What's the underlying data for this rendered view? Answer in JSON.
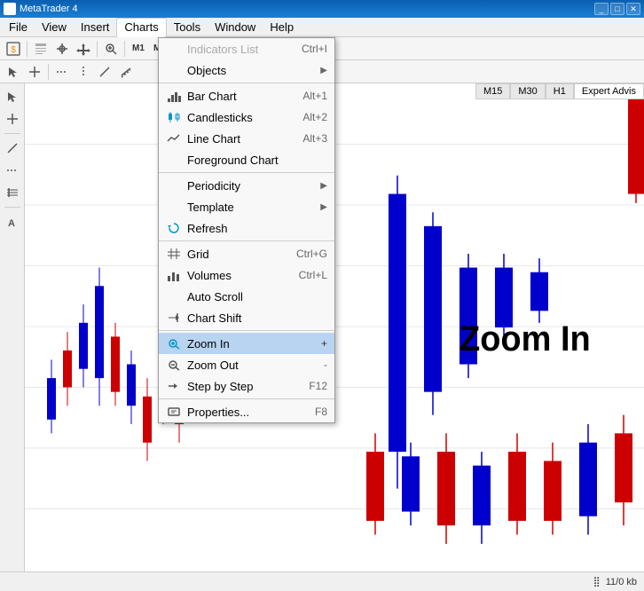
{
  "titlebar": {
    "text": "MetaTrader 4",
    "buttons": [
      "_",
      "□",
      "✕"
    ]
  },
  "menubar": {
    "items": [
      "File",
      "View",
      "Insert",
      "Charts",
      "Tools",
      "Window",
      "Help"
    ],
    "active": "Charts"
  },
  "dropdown": {
    "items": [
      {
        "id": "indicators-list",
        "label": "Indicators List",
        "shortcut": "Ctrl+I",
        "disabled": true,
        "hasIcon": false,
        "hasArrow": false
      },
      {
        "id": "objects",
        "label": "Objects",
        "shortcut": "",
        "disabled": false,
        "hasIcon": false,
        "hasArrow": true
      },
      {
        "id": "sep1",
        "type": "separator"
      },
      {
        "id": "bar-chart",
        "label": "Bar Chart",
        "shortcut": "Alt+1",
        "disabled": false,
        "hasIcon": true,
        "iconType": "bar",
        "hasArrow": false
      },
      {
        "id": "candlesticks",
        "label": "Candlesticks",
        "shortcut": "Alt+2",
        "disabled": false,
        "hasIcon": true,
        "iconType": "candle",
        "hasArrow": false
      },
      {
        "id": "line-chart",
        "label": "Line Chart",
        "shortcut": "Alt+3",
        "disabled": false,
        "hasIcon": true,
        "iconType": "line",
        "hasArrow": false
      },
      {
        "id": "foreground-chart",
        "label": "Foreground Chart",
        "shortcut": "",
        "disabled": false,
        "hasIcon": false,
        "hasArrow": false
      },
      {
        "id": "sep2",
        "type": "separator"
      },
      {
        "id": "periodicity",
        "label": "Periodicity",
        "shortcut": "",
        "disabled": false,
        "hasIcon": false,
        "hasArrow": true
      },
      {
        "id": "template",
        "label": "Template",
        "shortcut": "",
        "disabled": false,
        "hasIcon": false,
        "hasArrow": true
      },
      {
        "id": "refresh",
        "label": "Refresh",
        "shortcut": "",
        "disabled": false,
        "hasIcon": true,
        "iconType": "refresh",
        "hasArrow": false
      },
      {
        "id": "sep3",
        "type": "separator"
      },
      {
        "id": "grid",
        "label": "Grid",
        "shortcut": "Ctrl+G",
        "disabled": false,
        "hasIcon": true,
        "iconType": "grid",
        "hasArrow": false
      },
      {
        "id": "volumes",
        "label": "Volumes",
        "shortcut": "Ctrl+L",
        "disabled": false,
        "hasIcon": true,
        "iconType": "volumes",
        "hasArrow": false
      },
      {
        "id": "auto-scroll",
        "label": "Auto Scroll",
        "shortcut": "",
        "disabled": false,
        "hasIcon": false,
        "hasArrow": false
      },
      {
        "id": "chart-shift",
        "label": "Chart Shift",
        "shortcut": "",
        "disabled": false,
        "hasIcon": true,
        "iconType": "shift",
        "hasArrow": false
      },
      {
        "id": "sep4",
        "type": "separator"
      },
      {
        "id": "zoom-in",
        "label": "Zoom In",
        "shortcut": "+",
        "disabled": false,
        "hasIcon": true,
        "iconType": "zoom-in",
        "hasArrow": false,
        "highlighted": true
      },
      {
        "id": "zoom-out",
        "label": "Zoom Out",
        "shortcut": "-",
        "disabled": false,
        "hasIcon": true,
        "iconType": "zoom-out",
        "hasArrow": false
      },
      {
        "id": "step-by-step",
        "label": "Step by Step",
        "shortcut": "F12",
        "disabled": false,
        "hasIcon": true,
        "iconType": "step",
        "hasArrow": false
      },
      {
        "id": "sep5",
        "type": "separator"
      },
      {
        "id": "properties",
        "label": "Properties...",
        "shortcut": "F8",
        "disabled": false,
        "hasIcon": true,
        "iconType": "properties",
        "hasArrow": false
      }
    ]
  },
  "chart": {
    "zoom_in_text": "Zoom In",
    "tabs": [
      "M15",
      "M30",
      "H1"
    ],
    "expert_advisor_label": "Expert Advis"
  },
  "status_bar": {
    "value": "11/0 kb",
    "icon": "||||"
  }
}
